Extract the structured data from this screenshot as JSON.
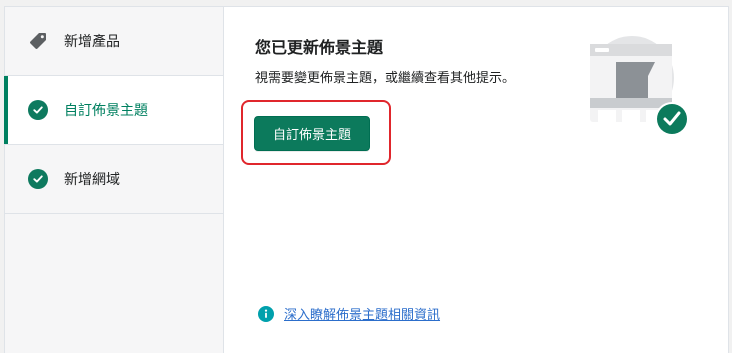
{
  "sidebar": {
    "items": [
      {
        "label": "新增產品",
        "icon": "tag-icon",
        "state": "default"
      },
      {
        "label": "自訂佈景主題",
        "icon": "check-circle-icon",
        "state": "active"
      },
      {
        "label": "新增網域",
        "icon": "check-circle-icon",
        "state": "done"
      }
    ]
  },
  "main": {
    "title": "您已更新佈景主題",
    "description": "視需要變更佈景主題，或繼續查看其他提示。",
    "primary_button": "自訂佈景主題",
    "learn_more": "深入瞭解佈景主題相關資訊",
    "illustration_icon": "theme-updated-illustration"
  },
  "colors": {
    "accent": "#008060",
    "highlight_border": "#e0262c",
    "link": "#2c6ecb",
    "info": "#00a0ac"
  }
}
